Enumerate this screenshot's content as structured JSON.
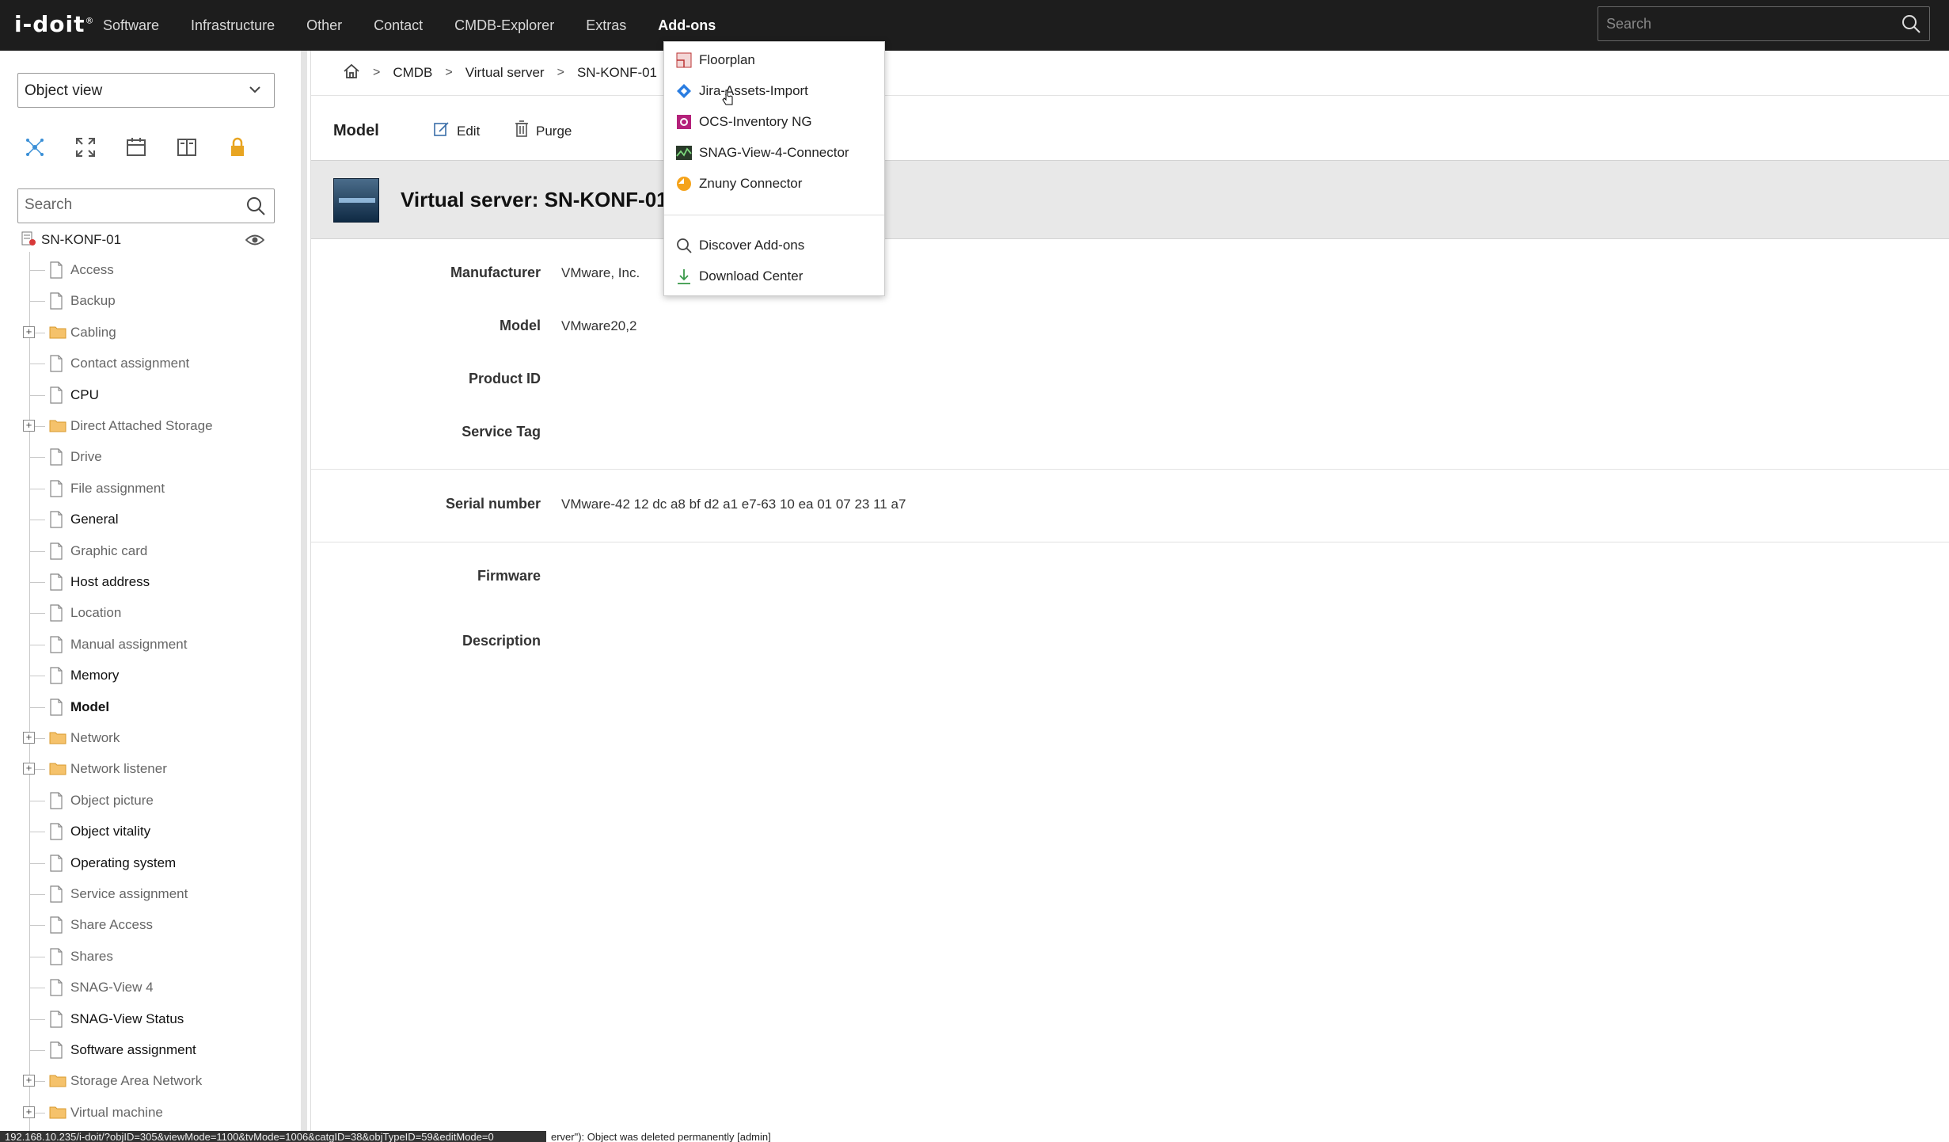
{
  "app": {
    "logo": "i-doit",
    "logo_mark": "®"
  },
  "nav": {
    "items": [
      "Software",
      "Infrastructure",
      "Other",
      "Contact",
      "CMDB-Explorer",
      "Extras",
      "Add-ons"
    ],
    "active": "Add-ons"
  },
  "top_search": {
    "placeholder": "Search"
  },
  "left": {
    "view_select": "Object view",
    "search_placeholder": "Search",
    "tree_root": "SN-KONF-01",
    "tree_items": [
      {
        "label": "Access",
        "type": "doc",
        "style": "grey",
        "expandable": false
      },
      {
        "label": "Backup",
        "type": "doc",
        "style": "grey",
        "expandable": false
      },
      {
        "label": "Cabling",
        "type": "folder",
        "style": "grey",
        "expandable": true
      },
      {
        "label": "Contact assignment",
        "type": "doc",
        "style": "grey",
        "expandable": false
      },
      {
        "label": "CPU",
        "type": "doc",
        "style": "dark",
        "expandable": false
      },
      {
        "label": "Direct Attached Storage",
        "type": "folder",
        "style": "grey",
        "expandable": true
      },
      {
        "label": "Drive",
        "type": "doc",
        "style": "grey",
        "expandable": false
      },
      {
        "label": "File assignment",
        "type": "doc",
        "style": "grey",
        "expandable": false
      },
      {
        "label": "General",
        "type": "doc",
        "style": "dark",
        "expandable": false
      },
      {
        "label": "Graphic card",
        "type": "doc",
        "style": "grey",
        "expandable": false
      },
      {
        "label": "Host address",
        "type": "doc",
        "style": "dark",
        "expandable": false
      },
      {
        "label": "Location",
        "type": "doc",
        "style": "grey",
        "expandable": false
      },
      {
        "label": "Manual assignment",
        "type": "doc",
        "style": "grey",
        "expandable": false
      },
      {
        "label": "Memory",
        "type": "doc",
        "style": "dark",
        "expandable": false
      },
      {
        "label": "Model",
        "type": "doc",
        "style": "bold",
        "expandable": false
      },
      {
        "label": "Network",
        "type": "folder",
        "style": "grey",
        "expandable": true
      },
      {
        "label": "Network listener",
        "type": "folder",
        "style": "grey",
        "expandable": true
      },
      {
        "label": "Object picture",
        "type": "doc",
        "style": "grey",
        "expandable": false
      },
      {
        "label": "Object vitality",
        "type": "doc",
        "style": "dark",
        "expandable": false
      },
      {
        "label": "Operating system",
        "type": "doc",
        "style": "dark",
        "expandable": false
      },
      {
        "label": "Service assignment",
        "type": "doc",
        "style": "grey",
        "expandable": false
      },
      {
        "label": "Share Access",
        "type": "doc",
        "style": "grey",
        "expandable": false
      },
      {
        "label": "Shares",
        "type": "doc",
        "style": "grey",
        "expandable": false
      },
      {
        "label": "SNAG-View 4",
        "type": "doc",
        "style": "grey",
        "expandable": false
      },
      {
        "label": "SNAG-View Status",
        "type": "doc",
        "style": "dark",
        "expandable": false
      },
      {
        "label": "Software assignment",
        "type": "doc",
        "style": "dark",
        "expandable": false
      },
      {
        "label": "Storage Area Network",
        "type": "folder",
        "style": "grey",
        "expandable": true
      },
      {
        "label": "Virtual machine",
        "type": "folder",
        "style": "grey",
        "expandable": true
      }
    ]
  },
  "breadcrumb": [
    "CMDB",
    "Virtual server",
    "SN-KONF-01"
  ],
  "toolbar": {
    "title": "Model",
    "edit": "Edit",
    "purge": "Purge"
  },
  "object": {
    "title": "Virtual server: SN-KONF-01"
  },
  "fields": {
    "manufacturer": {
      "label": "Manufacturer",
      "value": "VMware, Inc."
    },
    "model": {
      "label": "Model",
      "value": "VMware20,2"
    },
    "product_id": {
      "label": "Product ID",
      "value": ""
    },
    "service_tag": {
      "label": "Service Tag",
      "value": ""
    },
    "serial": {
      "label": "Serial number",
      "value": "VMware-42 12 dc a8 bf d2 a1 e7-63 10 ea 01 07 23 11 a7"
    },
    "firmware": {
      "label": "Firmware",
      "value": ""
    },
    "description": {
      "label": "Description",
      "value": ""
    }
  },
  "addons_menu": {
    "items": [
      "Floorplan",
      "Jira-Assets-Import",
      "OCS-Inventory NG",
      "SNAG-View-4-Connector",
      "Znuny Connector"
    ],
    "extra": [
      "Discover Add-ons",
      "Download Center"
    ]
  },
  "status": {
    "url": "192.168.10.235/i-doit/?objID=305&viewMode=1100&tvMode=1006&catgID=38&objTypeID=59&editMode=0",
    "message": "erver\"): Object was deleted permanently [admin]"
  }
}
